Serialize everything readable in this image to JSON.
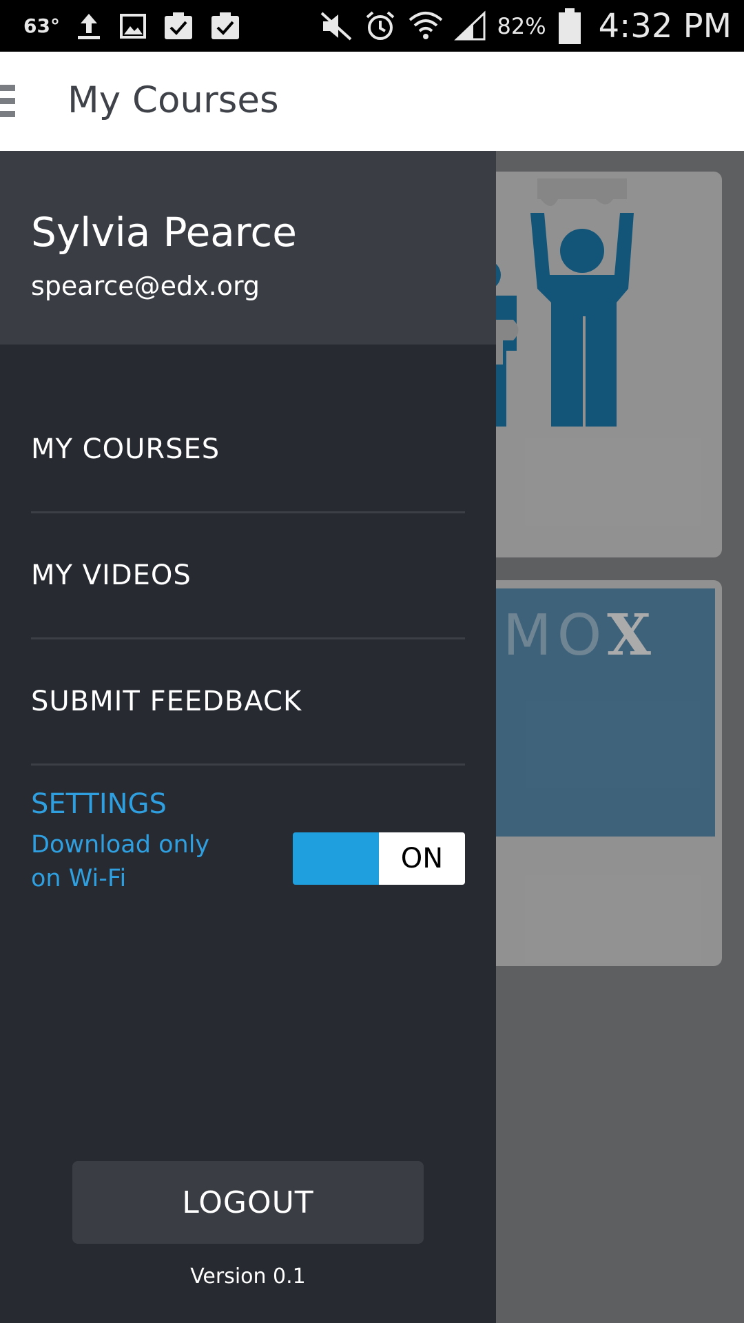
{
  "status_bar": {
    "temperature": "63°",
    "battery_percent": "82%",
    "time": "4:32 PM",
    "icons": [
      "upload-icon",
      "image-icon",
      "checklist-icon",
      "checklist-icon",
      "mute-icon",
      "alarm-icon",
      "wifi-icon",
      "signal-icon",
      "battery-icon"
    ]
  },
  "app_bar": {
    "title": "My Courses",
    "menu_icon": "hamburger-icon"
  },
  "drawer": {
    "user": {
      "name": "Sylvia Pearce",
      "email": "spearce@edx.org"
    },
    "nav_items": [
      {
        "label": "MY COURSES"
      },
      {
        "label": "MY VIDEOS"
      },
      {
        "label": "SUBMIT FEEDBACK"
      }
    ],
    "settings": {
      "title": "SETTINGS",
      "description": "Download only on Wi-Fi",
      "toggle_state": "ON"
    },
    "logout_label": "LOGOUT",
    "version": "Version 0.1"
  },
  "background": {
    "card2_logo_text": "MO",
    "card2_logo_mark": "X"
  },
  "colors": {
    "accent": "#1f9fde",
    "drawer_bg": "#272a30",
    "drawer_header_bg": "#3a3d43"
  }
}
